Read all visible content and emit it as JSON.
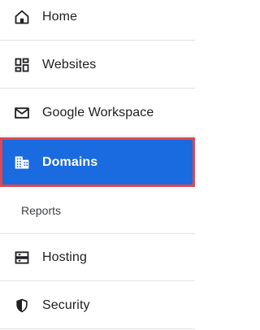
{
  "nav": {
    "items": [
      {
        "key": "home",
        "label": "Home",
        "icon": "home-icon"
      },
      {
        "key": "websites",
        "label": "Websites",
        "icon": "dashboard-icon"
      },
      {
        "key": "workspace",
        "label": "Google Workspace",
        "icon": "mail-icon"
      },
      {
        "key": "domains",
        "label": "Domains",
        "icon": "building-icon",
        "selected": true
      },
      {
        "key": "hosting",
        "label": "Hosting",
        "icon": "server-icon"
      },
      {
        "key": "security",
        "label": "Security",
        "icon": "shield-icon"
      }
    ],
    "subitems": [
      {
        "key": "reports",
        "label": "Reports"
      }
    ]
  },
  "colors": {
    "selected_bg": "#1a6ae0",
    "selected_outline": "#e0474e",
    "text": "#202124",
    "divider": "#e3e3e3"
  }
}
